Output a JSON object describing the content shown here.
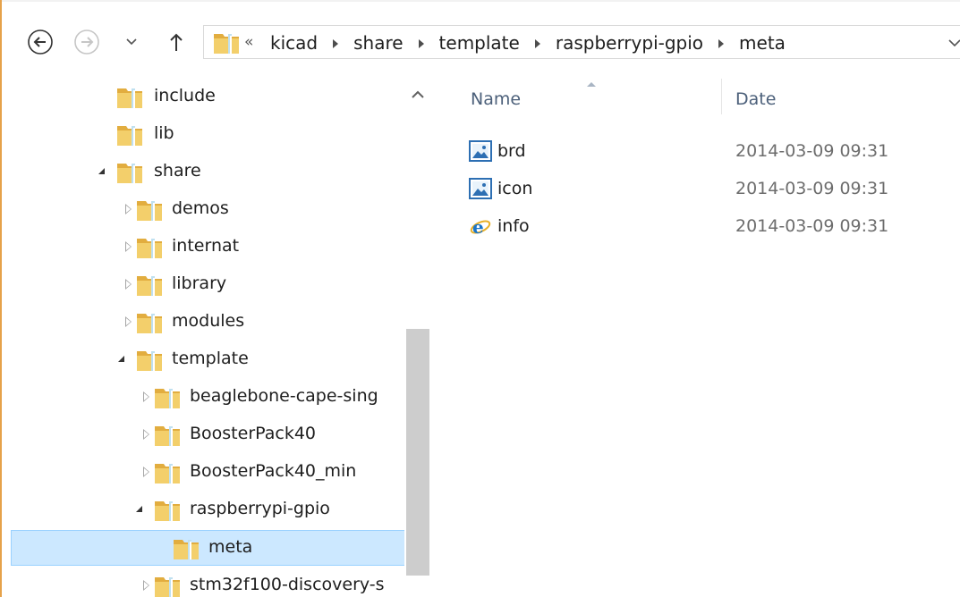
{
  "navigation": {
    "overflow_indicator": "«",
    "breadcrumbs": [
      "kicad",
      "share",
      "template",
      "raspberrypi-gpio",
      "meta"
    ]
  },
  "tree": {
    "items": [
      {
        "label": "include",
        "level": 0,
        "state": "none"
      },
      {
        "label": "lib",
        "level": 0,
        "state": "none"
      },
      {
        "label": "share",
        "level": 0,
        "state": "expanded"
      },
      {
        "label": "demos",
        "level": 1,
        "state": "collapsed"
      },
      {
        "label": "internat",
        "level": 1,
        "state": "collapsed"
      },
      {
        "label": "library",
        "level": 1,
        "state": "collapsed"
      },
      {
        "label": "modules",
        "level": 1,
        "state": "collapsed"
      },
      {
        "label": "template",
        "level": 1,
        "state": "expanded"
      },
      {
        "label": "beaglebone-cape-sing",
        "level": 2,
        "state": "collapsed"
      },
      {
        "label": "BoosterPack40",
        "level": 2,
        "state": "collapsed"
      },
      {
        "label": "BoosterPack40_min",
        "level": 2,
        "state": "collapsed"
      },
      {
        "label": "raspberrypi-gpio",
        "level": 2,
        "state": "expanded"
      },
      {
        "label": "meta",
        "level": 3,
        "state": "selected"
      },
      {
        "label": "stm32f100-discovery-s",
        "level": 2,
        "state": "collapsed"
      }
    ]
  },
  "files": {
    "columns": {
      "name": "Name",
      "date": "Date"
    },
    "rows": [
      {
        "name": "brd",
        "date": "2014-03-09 09:31",
        "icon": "image-file-icon"
      },
      {
        "name": "icon",
        "date": "2014-03-09 09:31",
        "icon": "image-file-icon"
      },
      {
        "name": "info",
        "date": "2014-03-09 09:31",
        "icon": "html-file-icon"
      }
    ]
  },
  "colors": {
    "selection": "#cce8ff",
    "selection_border": "#99d1ff",
    "header_text": "#4c607a",
    "folder": "#e8b84a"
  }
}
